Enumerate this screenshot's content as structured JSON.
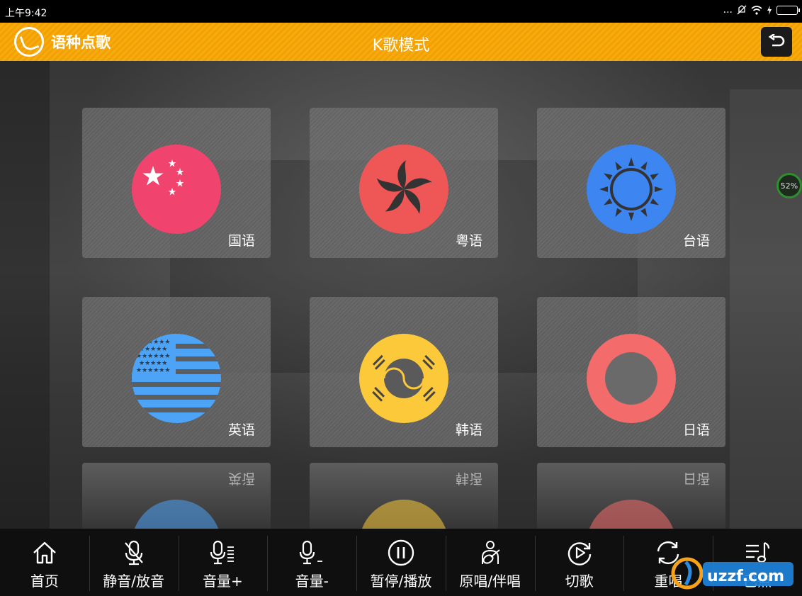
{
  "status_bar": {
    "time": "上午9:42",
    "dots": "...",
    "icons": [
      "mute-icon",
      "wifi-icon",
      "charging-icon",
      "battery-icon"
    ]
  },
  "header": {
    "app_title": "语种点歌",
    "mode_title": "K歌模式",
    "back_icon": "back-arrow-icon"
  },
  "colors": {
    "header": "#f2a100",
    "china": "#f0446f",
    "hongkong": "#ef5757",
    "taiwan": "#3d86f2",
    "usa": "#4da3f5",
    "korea": "#fcc93a",
    "japan": "#f46b6b"
  },
  "languages": [
    {
      "label": "国语",
      "icon": "china-flag-icon"
    },
    {
      "label": "粤语",
      "icon": "hongkong-flag-icon"
    },
    {
      "label": "台语",
      "icon": "taiwan-sun-icon"
    },
    {
      "label": "英语",
      "icon": "usa-flag-icon"
    },
    {
      "label": "韩语",
      "icon": "korea-flag-icon"
    },
    {
      "label": "日语",
      "icon": "japan-ring-icon"
    }
  ],
  "reflections": [
    {
      "label": "英语"
    },
    {
      "label": "韩语"
    },
    {
      "label": "日语"
    }
  ],
  "progress_badge": "52%",
  "toolbar": [
    {
      "label": "首页",
      "icon": "home-icon"
    },
    {
      "label": "静音/放音",
      "icon": "mic-mute-icon"
    },
    {
      "label": "音量+",
      "icon": "volume-up-icon"
    },
    {
      "label": "音量-",
      "icon": "volume-down-icon"
    },
    {
      "label": "暂停/播放",
      "icon": "pause-play-icon"
    },
    {
      "label": "原唱/伴唱",
      "icon": "guitar-icon"
    },
    {
      "label": "切歌",
      "icon": "next-song-icon"
    },
    {
      "label": "重唱",
      "icon": "replay-icon"
    },
    {
      "label": "已点",
      "icon": "playlist-icon"
    }
  ],
  "watermark": "uzzf.com"
}
